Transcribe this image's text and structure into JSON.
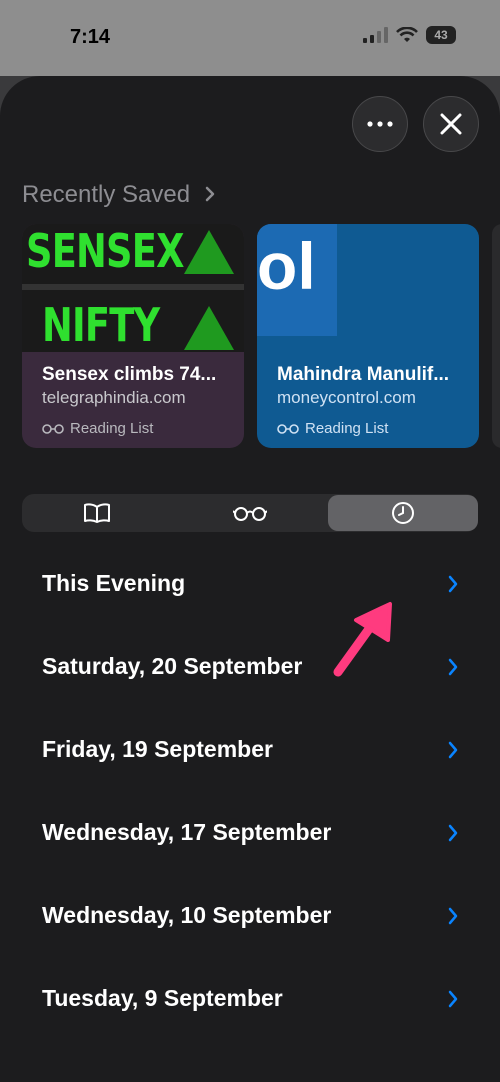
{
  "status_bar": {
    "time": "7:14",
    "battery": "43"
  },
  "recently_saved": {
    "title": "Recently Saved",
    "cards": [
      {
        "thumb_words": [
          "SENSEX",
          "NIFTY"
        ],
        "title": "Sensex climbs 74...",
        "domain": "telegraphindia.com",
        "tag": "Reading List"
      },
      {
        "thumb_text": "ol",
        "title": "Mahindra Manulif...",
        "domain": "moneycontrol.com",
        "tag": "Reading List"
      }
    ]
  },
  "segmented_control": {
    "tabs": [
      "bookmarks-icon",
      "reading-list-icon",
      "history-icon"
    ],
    "selected": "history-icon"
  },
  "history_sections": [
    {
      "label": "This Evening"
    },
    {
      "label": "Saturday, 20 September"
    },
    {
      "label": "Friday, 19 September"
    },
    {
      "label": "Wednesday, 17 September"
    },
    {
      "label": "Wednesday, 10 September"
    },
    {
      "label": "Tuesday, 9 September"
    }
  ],
  "colors": {
    "accent": "#0a84ff",
    "annotation_arrow": "#ff3b7f"
  }
}
